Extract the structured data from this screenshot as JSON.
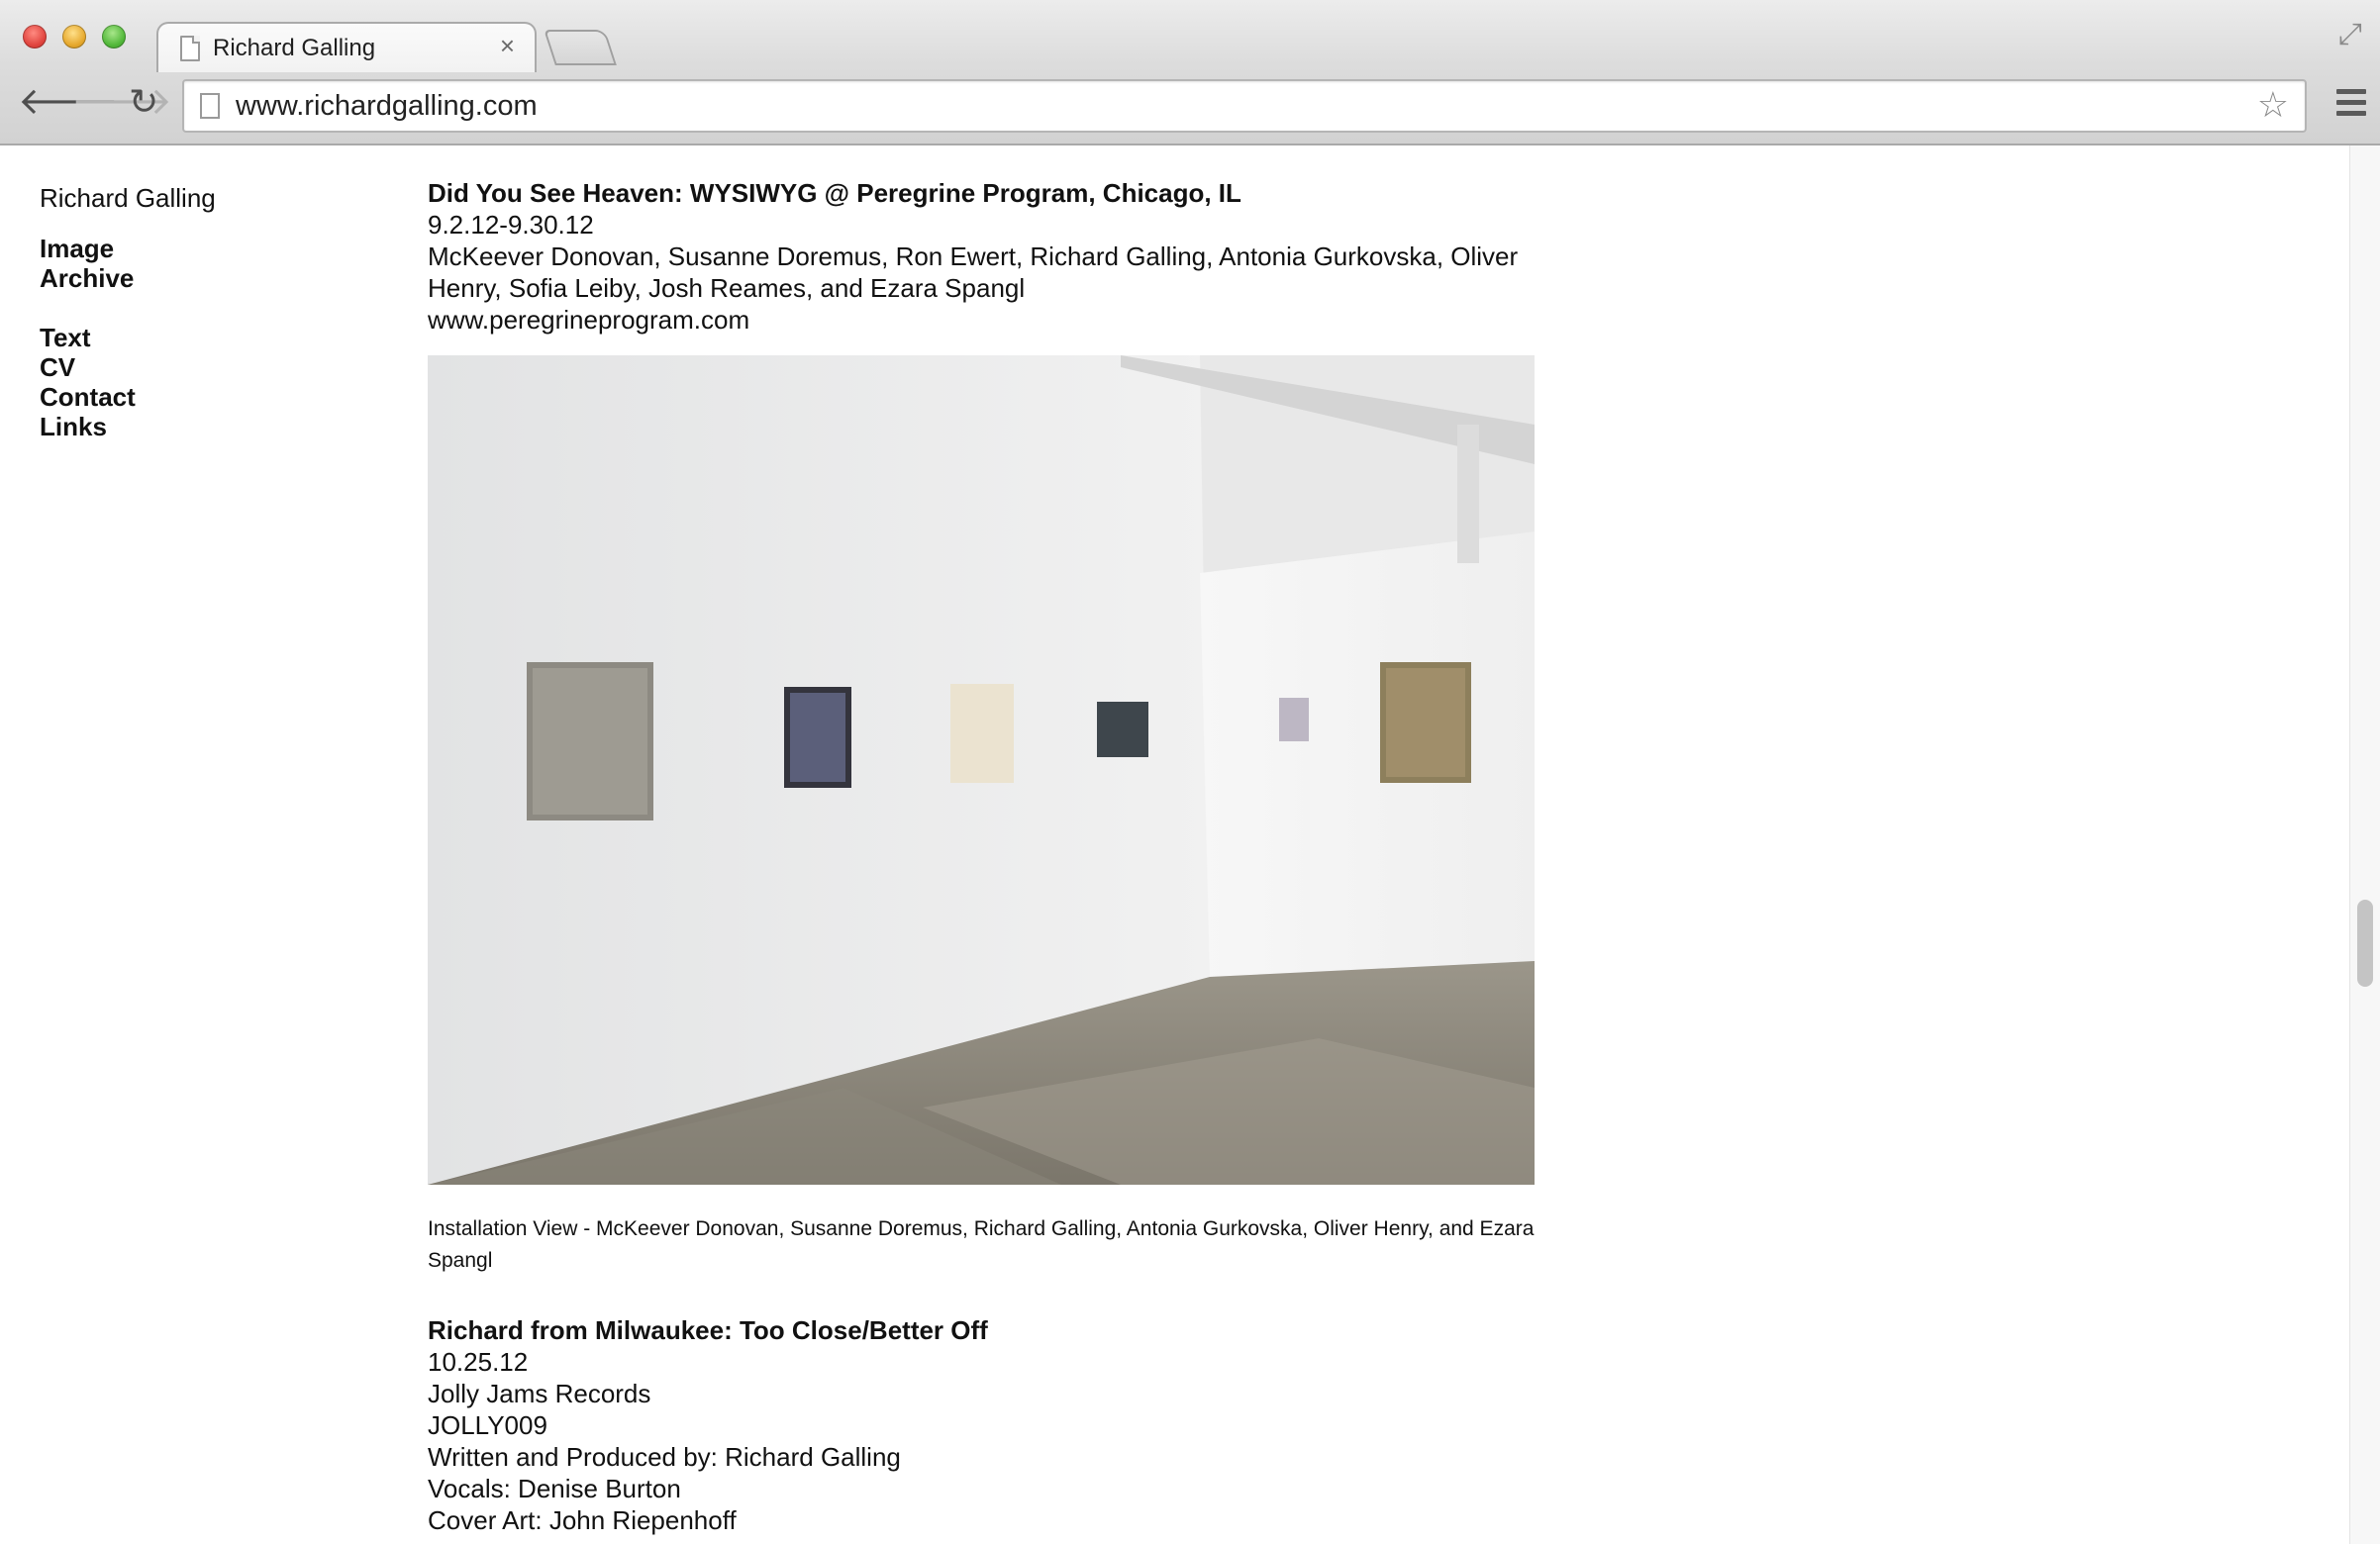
{
  "browser": {
    "tab_title": "Richard Galling",
    "tab_close": "×",
    "url": "www.richardgalling.com",
    "icons": {
      "back": "back-arrow-icon",
      "forward": "forward-arrow-icon",
      "reload": "reload-icon",
      "star": "bookmark-star-icon",
      "menu": "hamburger-menu-icon",
      "fullscreen": "fullscreen-icon"
    }
  },
  "sidebar": {
    "site_name": "Richard Galling",
    "group1": [
      "Image",
      "Archive"
    ],
    "group2": [
      "Text",
      "CV",
      "Contact",
      "Links"
    ]
  },
  "entries": [
    {
      "title": "Did You See Heaven: WYSIWYG @ Peregrine Program, Chicago, IL",
      "date": "9.2.12-9.30.12",
      "artists_line1": "McKeever Donovan, Susanne Doremus, Ron Ewert, Richard Galling, Antonia Gurkovska, Oliver",
      "artists_line2": "Henry, Sofia Leiby, Josh Reames, and Ezara Spangl",
      "website": "www.peregrineprogram.com",
      "caption": "Installation View - McKeever Donovan, Susanne Doremus, Richard Galling, Antonia Gurkovska, Oliver Henry, and Ezara Spangl"
    },
    {
      "title": "Richard from Milwaukee: Too Close/Better Off",
      "lines": [
        "10.25.12",
        "Jolly Jams Records",
        "JOLLY009",
        "Written and Produced by: Richard Galling",
        "Vocals: Denise Burton",
        "Cover Art: John Riepenhoff"
      ]
    }
  ]
}
